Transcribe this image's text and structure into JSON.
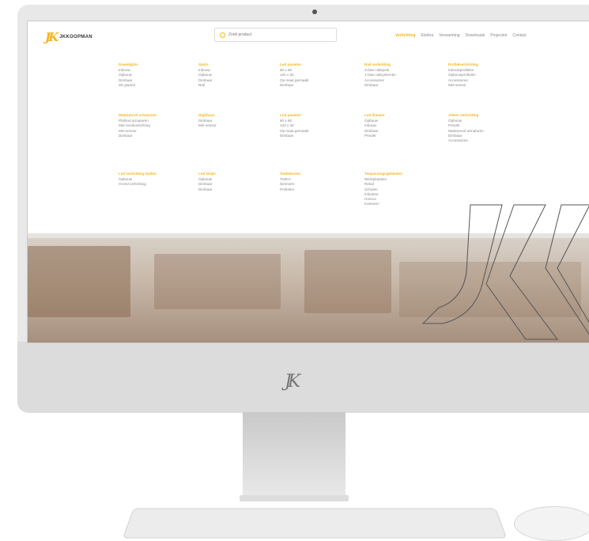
{
  "brand": {
    "mark": "JK",
    "name": "JKKOOPMAN"
  },
  "search": {
    "placeholder": "Zoek product"
  },
  "nav": {
    "items": [
      "Verlichting",
      "Elektra",
      "Verwarming",
      "Downloads",
      "Projecten",
      "Contact"
    ],
    "active_index": 0
  },
  "menu": {
    "columns": [
      {
        "title": "Downlights",
        "items": [
          "Inbouw",
          "Opbouw",
          "Dimbaar",
          "3D gepind"
        ]
      },
      {
        "title": "Spots",
        "items": [
          "Inbouw",
          "Opbouw",
          "Dimbaar",
          "Rail"
        ]
      },
      {
        "title": "Led panelen",
        "items": [
          "60 x 60",
          "120 x 30",
          "Op maat gemaakt",
          "Dimbaar"
        ]
      },
      {
        "title": "Rail verlichting",
        "items": [
          "3-fase railspots",
          "1-fase railsystemen",
          "Accessoires",
          "Dimbaar"
        ]
      },
      {
        "title": "Profielverlichting",
        "items": [
          "Inbouwprofielen",
          "Opbouwprofielen",
          "Accessoires",
          "Met sensor"
        ]
      },
      {
        "title": "Waterproof armaturen",
        "items": [
          "Plafond armaturen",
          "Met noodverlichting",
          "Met sensor",
          "Dimbaar"
        ]
      },
      {
        "title": "Highbays",
        "items": [
          "Dimbaar",
          "Met sensor"
        ]
      },
      {
        "title": "Led panelen",
        "items": [
          "60 x 60",
          "120 x 30",
          "Op maat gemaakt",
          "Dimbaar"
        ]
      },
      {
        "title": "Led lineaire",
        "items": [
          "Opbouw",
          "Inbouw",
          "Dimbaar",
          "Pendel"
        ]
      },
      {
        "title": "Alleen verlichting",
        "items": [
          "Opbouw",
          "Pendel",
          "Waterproof armaturen",
          "Dimbaar",
          "Accessoires"
        ]
      },
      {
        "title": "Led verlichting buiten",
        "items": [
          "Opbouw",
          "Grond verlichting"
        ]
      },
      {
        "title": "Led strips",
        "items": [
          "Opbouw",
          "Dimbaar",
          "Dimbaar"
        ]
      },
      {
        "title": "Toebehoren",
        "items": [
          "Trafo's",
          "Dimmers",
          "Profielen"
        ]
      },
      {
        "title": "Toepassingsgebieden",
        "items": [
          "Werkplaatsen",
          "Retail",
          "Scholen",
          "Industrie",
          "Horeca",
          "Kantoren"
        ]
      }
    ]
  },
  "chin": {
    "mark": "JK"
  },
  "colors": {
    "accent": "#f3b61f",
    "text": "#888888"
  }
}
